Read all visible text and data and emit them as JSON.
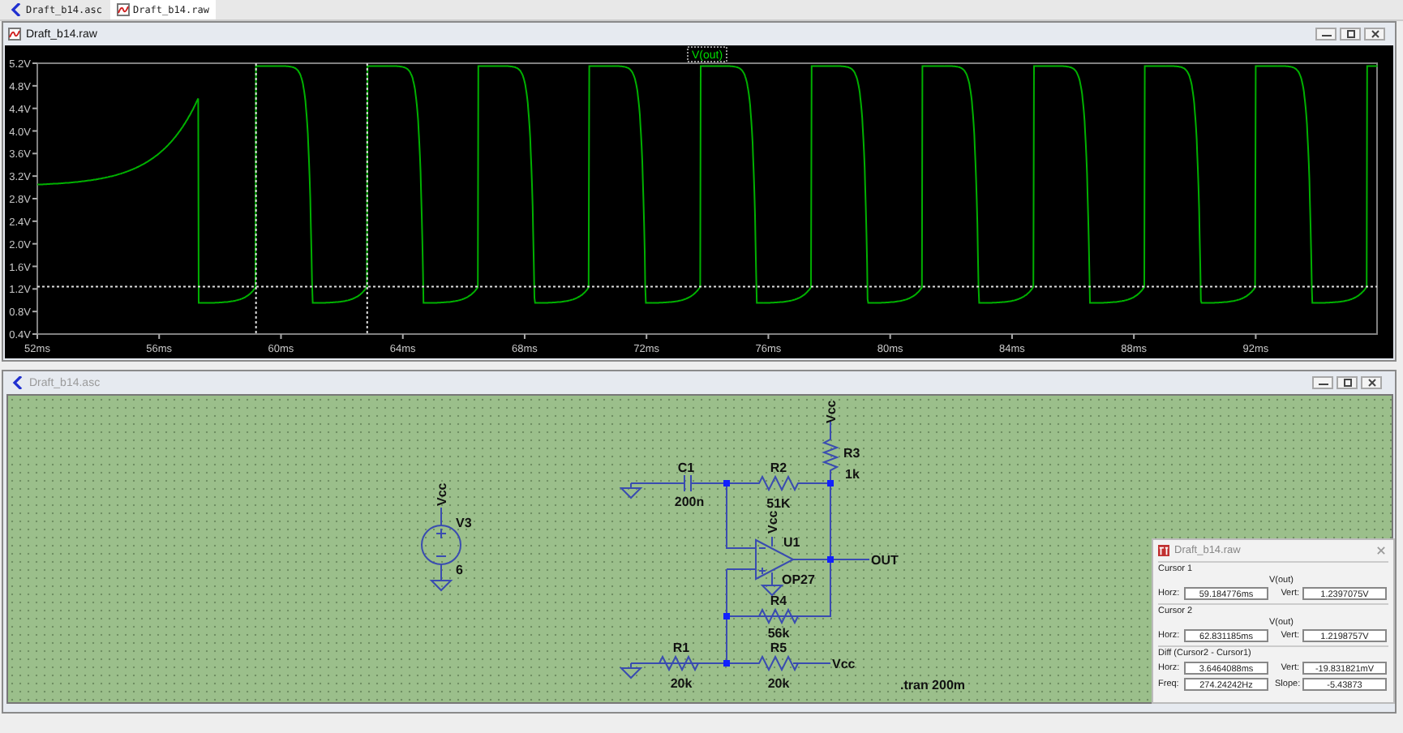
{
  "tabs": [
    {
      "label": "Draft_b14.asc",
      "kind": "schematic",
      "selected": false
    },
    {
      "label": "Draft_b14.raw",
      "kind": "waveform",
      "selected": true
    }
  ],
  "plot_window": {
    "title": "Draft_b14.raw",
    "trace_label": "V(out)",
    "y_labels": [
      "5.2V",
      "4.8V",
      "4.4V",
      "4.0V",
      "3.6V",
      "3.2V",
      "2.8V",
      "2.4V",
      "2.0V",
      "1.6V",
      "1.2V",
      "0.8V",
      "0.4V"
    ],
    "x_labels": [
      "52ms",
      "56ms",
      "60ms",
      "64ms",
      "68ms",
      "72ms",
      "76ms",
      "80ms",
      "84ms",
      "88ms",
      "92ms"
    ]
  },
  "schematic_window": {
    "title": "Draft_b14.asc",
    "parts": {
      "c1": {
        "ref": "C1",
        "value": "200n"
      },
      "r2": {
        "ref": "R2",
        "value": "51K"
      },
      "r3": {
        "ref": "R3",
        "value": "1k"
      },
      "u1": {
        "ref": "U1",
        "value": "OP27"
      },
      "r4": {
        "ref": "R4",
        "value": "56k"
      },
      "r1": {
        "ref": "R1",
        "value": "20k"
      },
      "r5": {
        "ref": "R5",
        "value": "20k"
      },
      "v3": {
        "ref": "V3",
        "value": "6"
      }
    },
    "net_labels": {
      "vcc_v3": "Vcc",
      "vcc_r3": "Vcc",
      "vcc_u1": "Vcc",
      "vcc_r5": "Vcc",
      "out": "OUT"
    },
    "directive": ".tran 200m"
  },
  "cursor_dialog": {
    "title": "Draft_b14.raw",
    "cursor1": {
      "heading": "Cursor 1",
      "trace": "V(out)",
      "horz_label": "Horz:",
      "horz": "59.184776ms",
      "vert_label": "Vert:",
      "vert": "1.2397075V"
    },
    "cursor2": {
      "heading": "Cursor 2",
      "trace": "V(out)",
      "horz_label": "Horz:",
      "horz": "62.831185ms",
      "vert_label": "Vert:",
      "vert": "1.2198757V"
    },
    "diff": {
      "heading": "Diff (Cursor2 - Cursor1)",
      "horz_label": "Horz:",
      "horz": "3.6464088ms",
      "vert_label": "Vert:",
      "vert": "-19.831821mV",
      "freq_label": "Freq:",
      "freq": "274.24242Hz",
      "slope_label": "Slope:",
      "slope": "-5.43873"
    }
  }
}
